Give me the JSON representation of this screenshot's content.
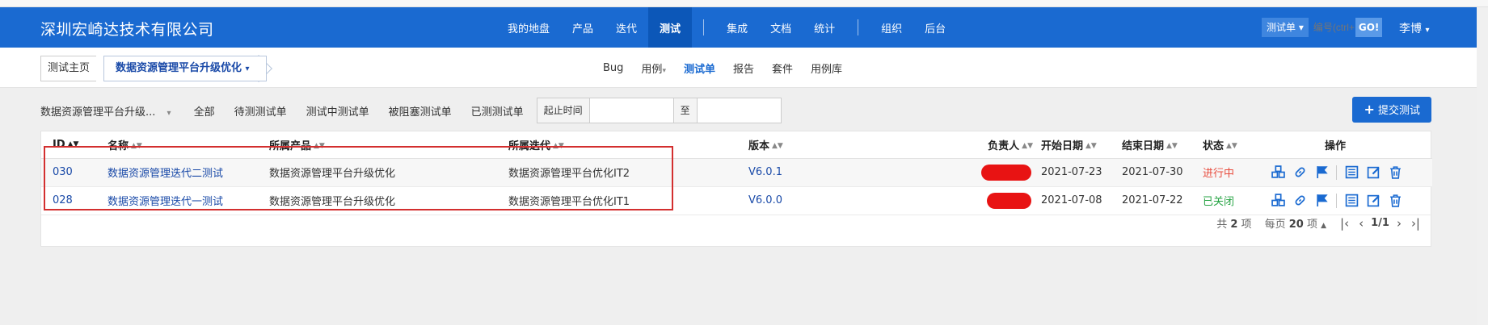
{
  "header": {
    "brand": "深圳宏崎达技术有限公司",
    "nav_main": [
      "我的地盘",
      "产品",
      "迭代",
      "测试"
    ],
    "nav_mid": [
      "集成",
      "文档",
      "统计"
    ],
    "nav_right": [
      "组织",
      "后台"
    ],
    "active": "测试",
    "search_type": "测试单",
    "search_placeholder": "编号(ctrl+",
    "search_go": "GO!",
    "user": "李博"
  },
  "breadcrumb": {
    "home": "测试主页",
    "current": "数据资源管理平台升级优化"
  },
  "subnav": {
    "items": [
      "Bug",
      "用例",
      "测试单",
      "报告",
      "套件",
      "用例库"
    ],
    "active": "测试单"
  },
  "filters": {
    "product_select": "数据资源管理平台升级...",
    "tabs": [
      "全部",
      "待测测试单",
      "测试中测试单",
      "被阻塞测试单",
      "已测测试单"
    ],
    "date_label": "起止时间",
    "date_to": "至",
    "submit": "提交测试"
  },
  "table": {
    "columns": [
      "ID",
      "名称",
      "所属产品",
      "所属迭代",
      "版本",
      "负责人",
      "开始日期",
      "结束日期",
      "状态",
      "操作"
    ],
    "rows": [
      {
        "id": "030",
        "name": "数据资源管理迭代二测试",
        "product": "数据资源管理平台升级优化",
        "iteration": "数据资源管理平台优化IT2",
        "version": "V6.0.1",
        "start": "2021-07-23",
        "end": "2021-07-30",
        "status": "进行中"
      },
      {
        "id": "028",
        "name": "数据资源管理迭代一测试",
        "product": "数据资源管理平台升级优化",
        "iteration": "数据资源管理平台优化IT1",
        "version": "V6.0.0",
        "start": "2021-07-08",
        "end": "2021-07-22",
        "status": "已关闭"
      }
    ]
  },
  "pager": {
    "total_prefix": "共",
    "total": "2",
    "total_suffix": "项",
    "per_page_prefix": "每页",
    "per_page": "20",
    "per_page_suffix": "项",
    "page": "1/1"
  },
  "colors": {
    "topbar": "#1a6ad1",
    "running": "#e84b3c",
    "closed": "#26a343",
    "highlight": "#d32f2f"
  }
}
